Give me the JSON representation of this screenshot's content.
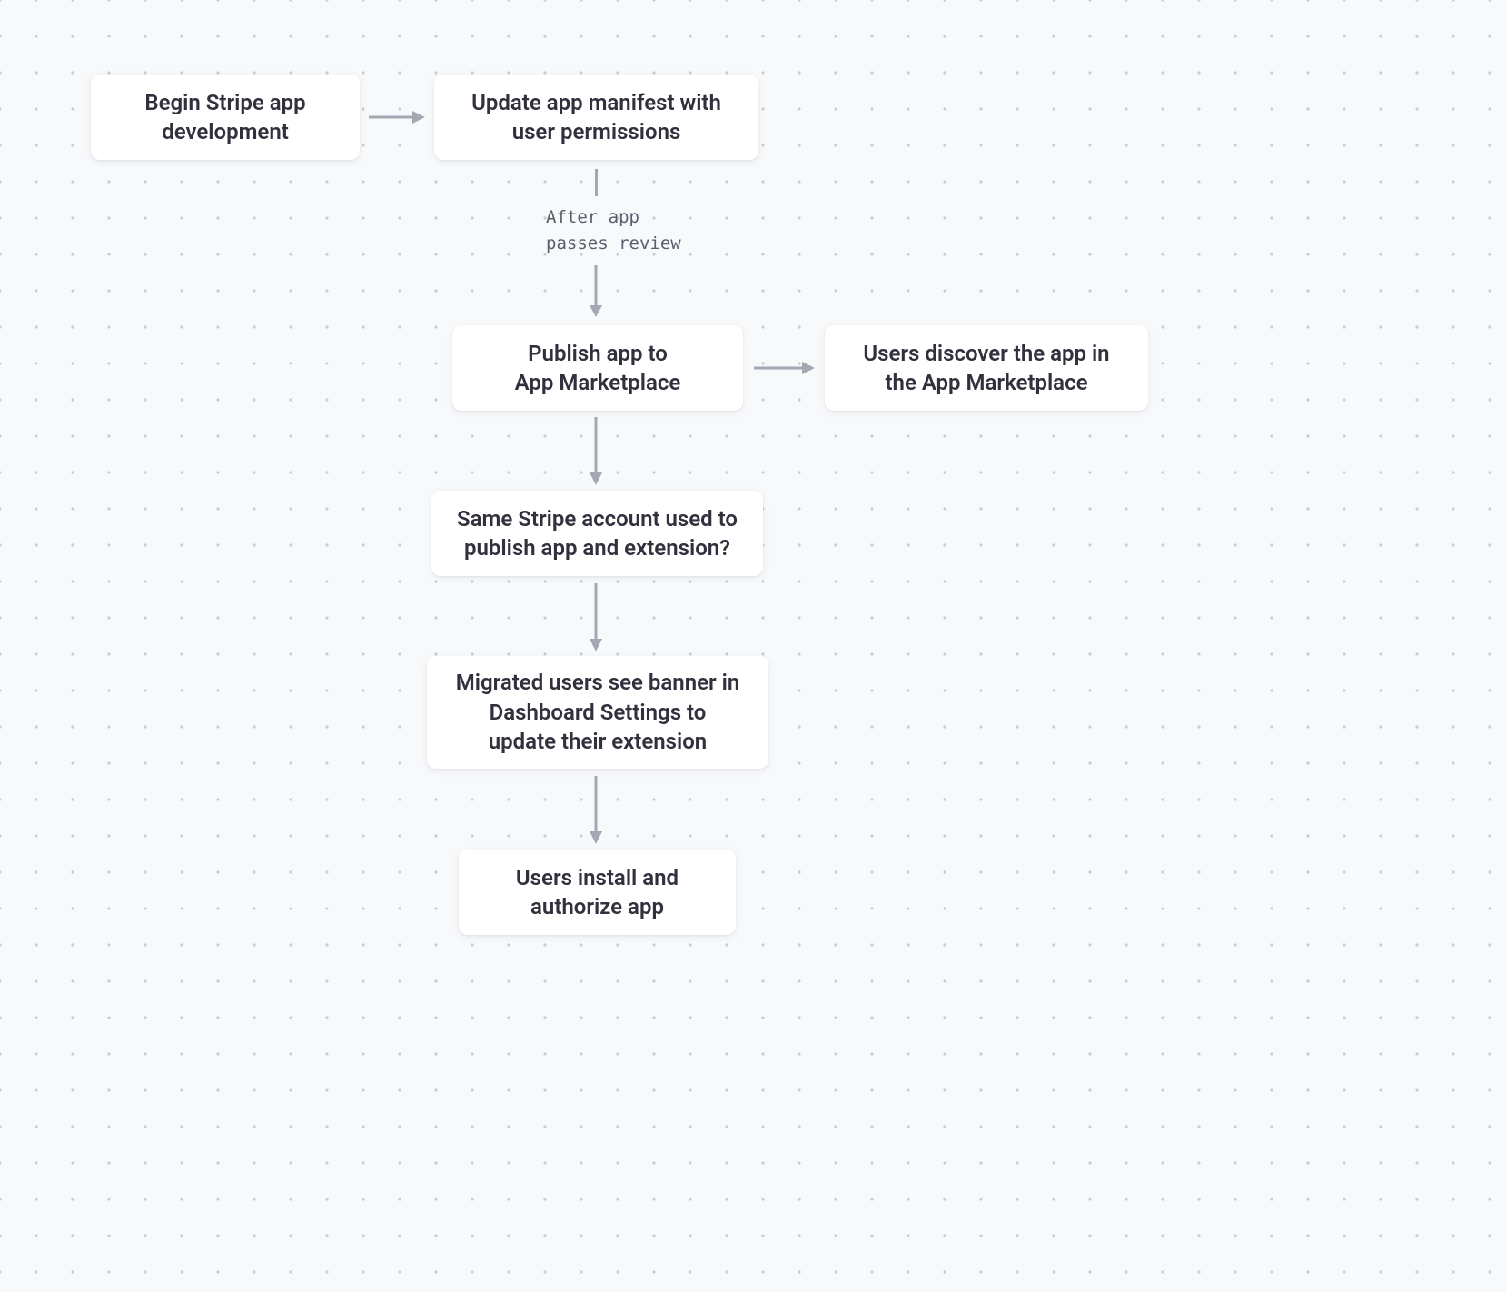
{
  "nodes": {
    "begin": "Begin Stripe app\ndevelopment",
    "manifest": "Update app manifest with\nuser permissions",
    "publish": "Publish app to\nApp Marketplace",
    "discover": "Users discover the app in\nthe App Marketplace",
    "sameaccount": "Same Stripe account used to\npublish app and extension?",
    "banner": "Migrated users see banner in\nDashboard Settings to\nupdate their extension",
    "install": "Users install and\nauthorize app"
  },
  "annotations": {
    "review": "After app\npasses review"
  }
}
